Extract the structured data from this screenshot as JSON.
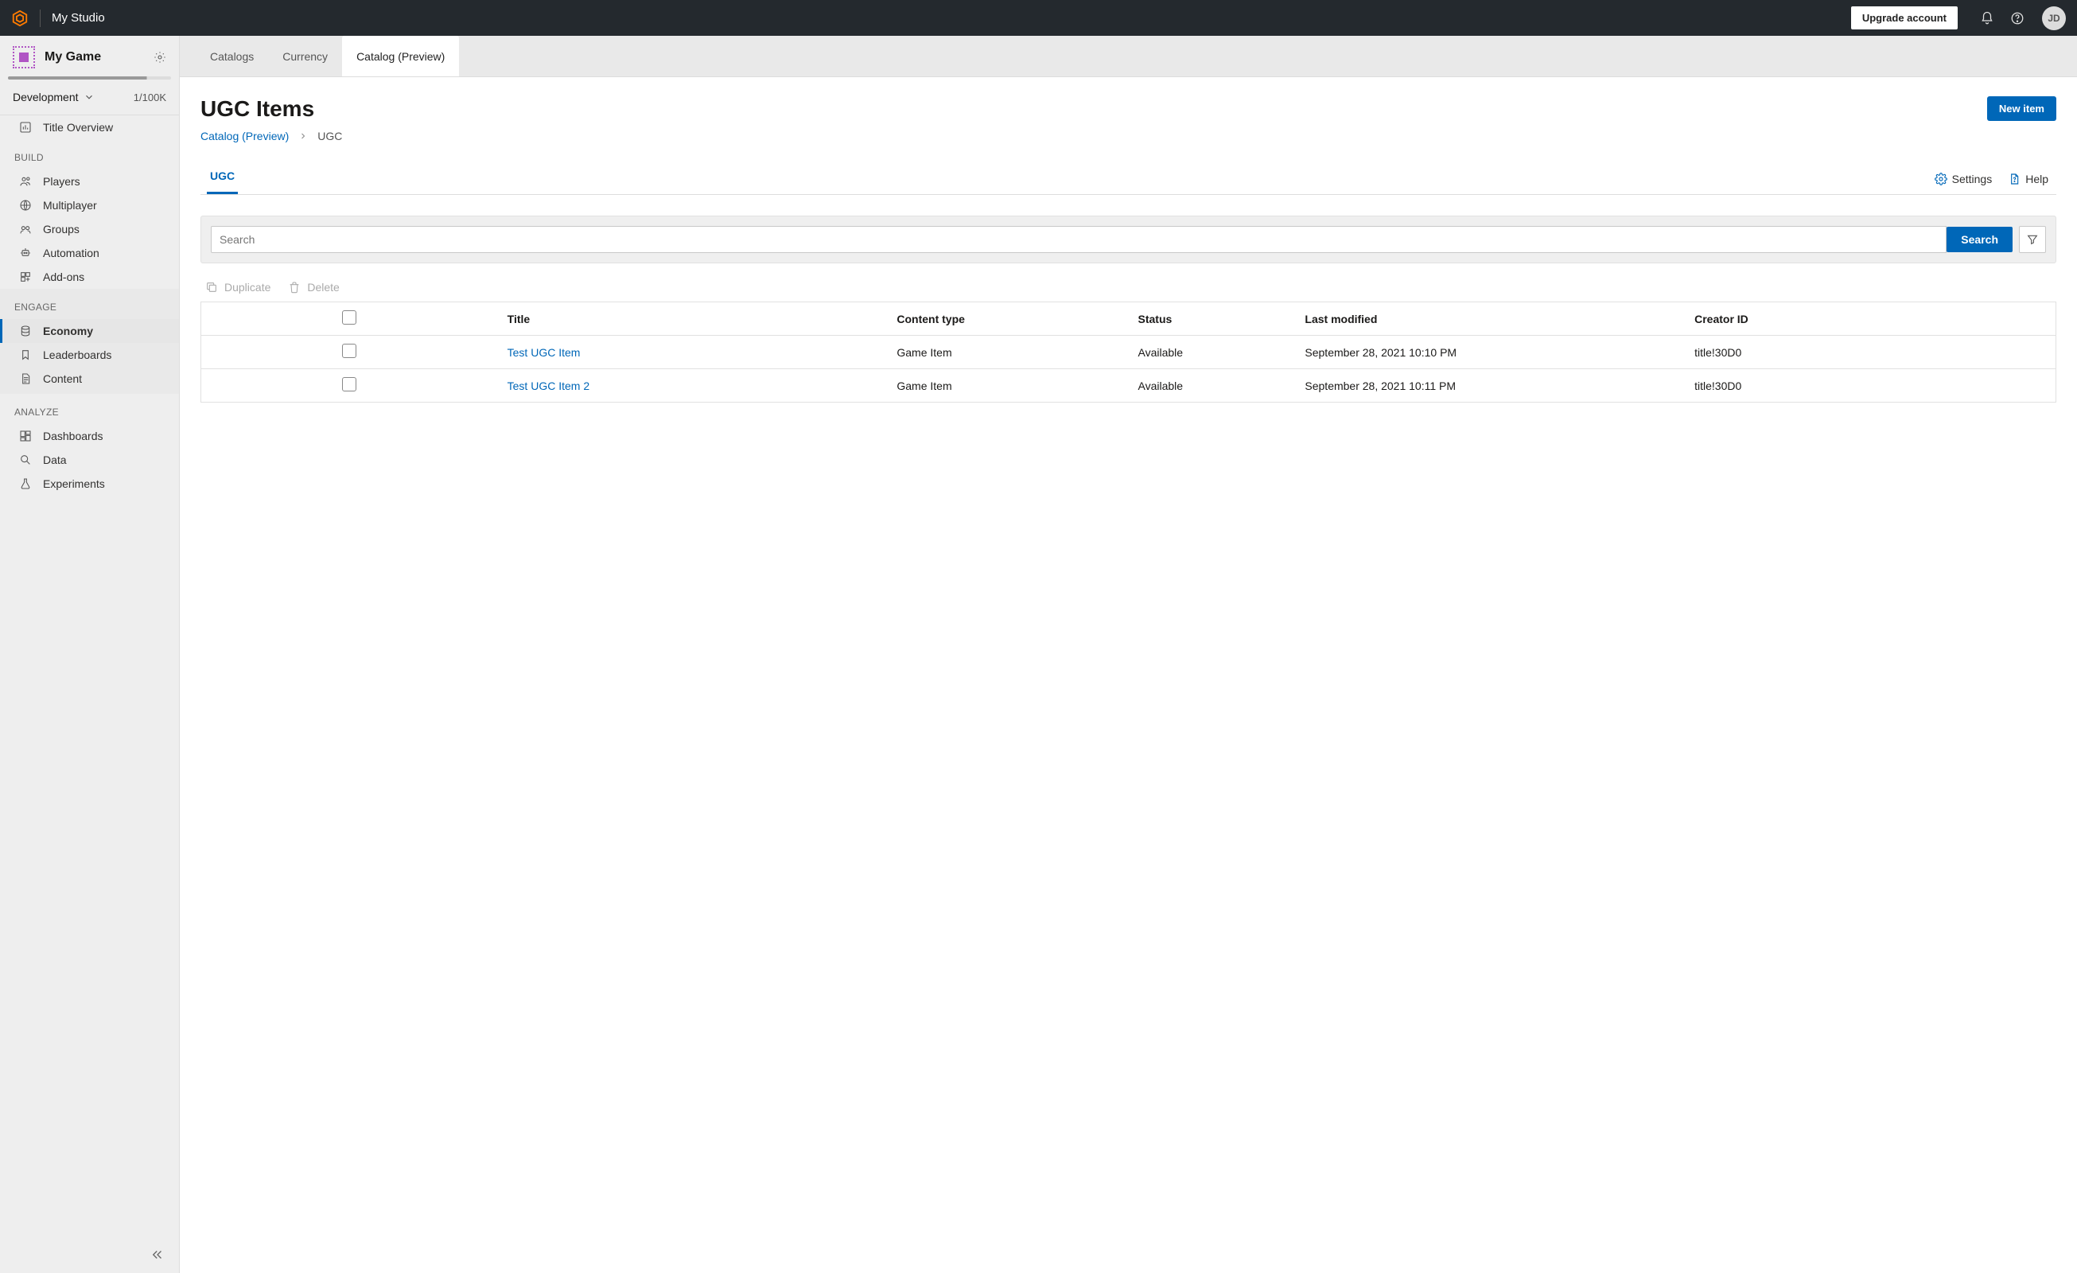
{
  "topbar": {
    "studio": "My Studio",
    "upgrade": "Upgrade account",
    "avatar": "JD"
  },
  "sidebar": {
    "game": "My Game",
    "env": "Development",
    "envCount": "1/100K",
    "overview": "Title Overview",
    "sections": {
      "build": "BUILD",
      "engage": "ENGAGE",
      "analyze": "ANALYZE"
    },
    "build": [
      "Players",
      "Multiplayer",
      "Groups",
      "Automation",
      "Add-ons"
    ],
    "engage": [
      "Economy",
      "Leaderboards",
      "Content"
    ],
    "analyze": [
      "Dashboards",
      "Data",
      "Experiments"
    ]
  },
  "tabs": [
    "Catalogs",
    "Currency",
    "Catalog (Preview)"
  ],
  "page": {
    "title": "UGC Items",
    "newItem": "New item",
    "breadcrumbRoot": "Catalog (Preview)",
    "breadcrumbCurrent": "UGC",
    "subtab": "UGC",
    "settings": "Settings",
    "help": "Help"
  },
  "search": {
    "placeholder": "Search",
    "button": "Search"
  },
  "actions": {
    "duplicate": "Duplicate",
    "delete": "Delete"
  },
  "table": {
    "headers": [
      "Title",
      "Content type",
      "Status",
      "Last modified",
      "Creator ID"
    ],
    "rows": [
      {
        "title": "Test UGC Item",
        "contentType": "Game Item",
        "status": "Available",
        "lastModified": "September 28, 2021 10:10 PM",
        "creatorId": "title!30D0"
      },
      {
        "title": "Test UGC Item 2",
        "contentType": "Game Item",
        "status": "Available",
        "lastModified": "September 28, 2021 10:11 PM",
        "creatorId": "title!30D0"
      }
    ]
  }
}
